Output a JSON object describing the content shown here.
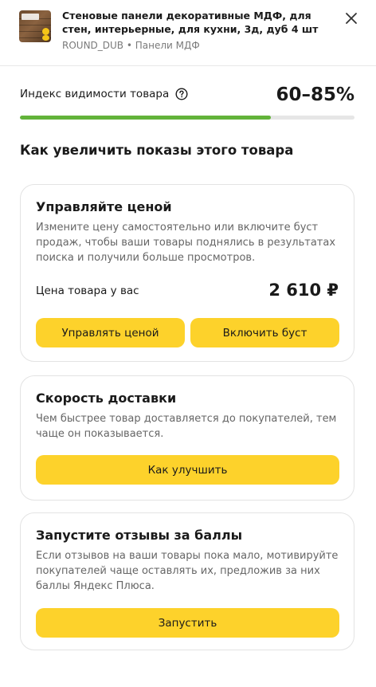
{
  "product": {
    "title": "Стеновые панели декоративные МДФ, для стен, интерьерные, для кухни, 3д, дуб 4 шт",
    "meta": "ROUND_DUB • Панели МДФ",
    "thumbnail_icon": "wood-panel-product-image"
  },
  "visibility": {
    "label": "Индекс видимости товара",
    "value": "60–85%",
    "progress_fraction": 0.75,
    "progress_color": "#62b33a"
  },
  "section": {
    "title": "Как увеличить показы этого товара"
  },
  "cards": {
    "price": {
      "title": "Управляйте ценой",
      "text": "Измените цену самостоятельно или включите буст продаж, чтобы ваши товары поднялись в результатах поиска и получили больше просмотров.",
      "price_label": "Цена товара у вас",
      "price_value": "2 610 ₽",
      "manage_button": "Управлять ценой",
      "boost_button": "Включить буст"
    },
    "delivery": {
      "title": "Скорость доставки",
      "text": "Чем быстрее товар доставляется до покупателей, тем чаще он показывается.",
      "button": "Как улучшить"
    },
    "reviews": {
      "title": "Запустите отзывы за баллы",
      "text": "Если отзывов на ваши товары пока мало, мотивируйте покупателей чаще оставлять их, предложив за них баллы Яндекс Плюса.",
      "button": "Запустить"
    }
  },
  "colors": {
    "accent_button": "#fdd22b",
    "progress_track": "#e6e6e6"
  }
}
